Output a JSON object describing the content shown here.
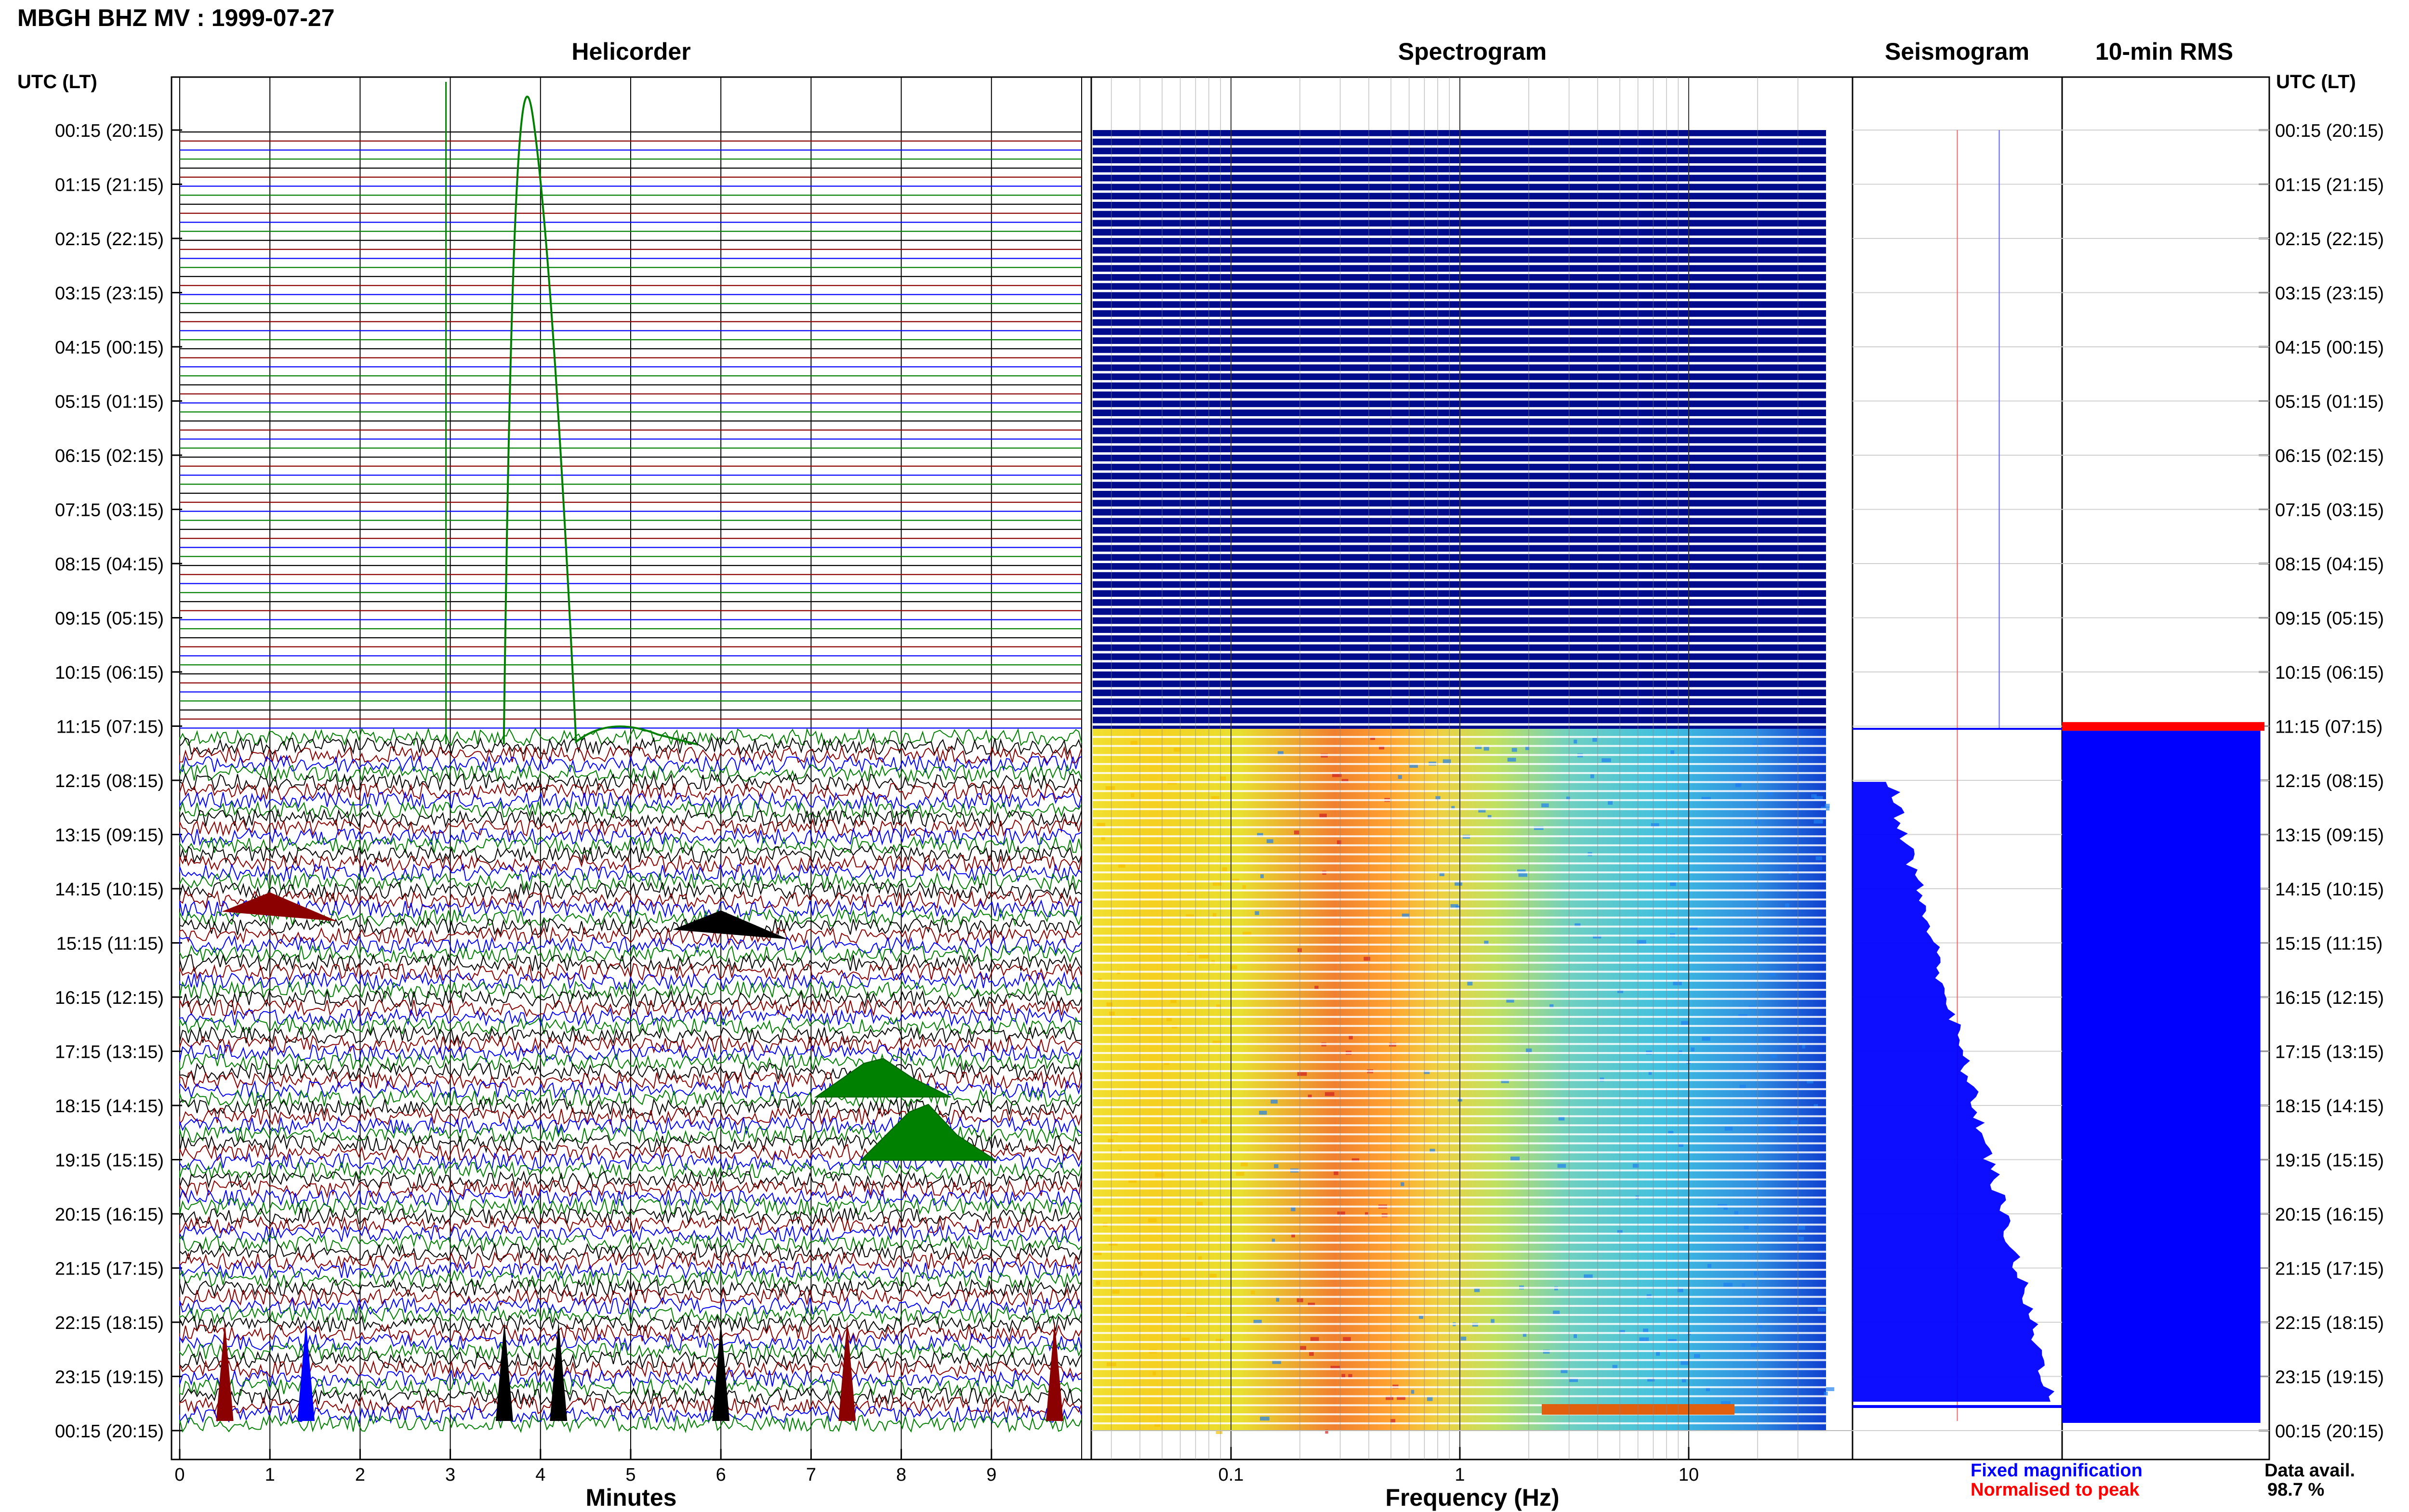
{
  "header": {
    "title": "MBGH BHZ MV : 1999-07-27"
  },
  "panels": {
    "helicorder": "Helicorder",
    "spectrogram": "Spectrogram",
    "seismogram": "Seismogram",
    "rms": "10-min RMS"
  },
  "axes": {
    "utc_label_left": "UTC (LT)",
    "utc_label_right": "UTC (LT)",
    "time_labels": [
      "00:15 (20:15)",
      "01:15 (21:15)",
      "02:15 (22:15)",
      "03:15 (23:15)",
      "04:15 (00:15)",
      "05:15 (01:15)",
      "06:15 (02:15)",
      "07:15 (03:15)",
      "08:15 (04:15)",
      "09:15 (05:15)",
      "10:15 (06:15)",
      "11:15 (07:15)",
      "12:15 (08:15)",
      "13:15 (09:15)",
      "14:15 (10:15)",
      "15:15 (11:15)",
      "16:15 (12:15)",
      "17:15 (13:15)",
      "18:15 (14:15)",
      "19:15 (15:15)",
      "20:15 (16:15)",
      "21:15 (17:15)",
      "22:15 (18:15)",
      "23:15 (19:15)",
      "00:15 (20:15)"
    ],
    "minutes_label": "Minutes",
    "minutes_ticks": [
      "0",
      "1",
      "2",
      "3",
      "4",
      "5",
      "6",
      "7",
      "8",
      "9"
    ],
    "frequency_label": "Frequency (Hz)",
    "frequency_ticks": [
      "0.1",
      "1",
      "10"
    ]
  },
  "legend": {
    "fixed": "Fixed magnification",
    "normalised": "Normalised to peak",
    "fixed_color": "#0000ff",
    "normalised_color": "#ff0000"
  },
  "availability": {
    "label": "Data avail.",
    "value": "98.7 %"
  },
  "colors": {
    "trace_cycle": [
      "#000000",
      "#8b0000",
      "#0000ff",
      "#008000"
    ],
    "spectrogram_empty": "#000c8c",
    "rms_fill": "#0000ff",
    "rms_peak": "#ff0000"
  },
  "chart_data": {
    "type": "heatmap",
    "title": "MBGH BHZ MV : 1999-07-27",
    "data_start_hour_utc": 11.3,
    "helicorder": {
      "xlabel": "Minutes",
      "xlim": [
        0,
        10
      ],
      "rows_per_hour": 6,
      "events": [
        {
          "start_utc": "11:35",
          "minute": 3.7,
          "type": "spike"
        },
        {
          "start_utc": "14:35",
          "minute": 1.0,
          "type": "burst"
        },
        {
          "start_utc": "14:55",
          "minute": 6.0,
          "type": "burst"
        },
        {
          "start_utc": "17:55",
          "minute": 7.8,
          "type": "tremor"
        },
        {
          "start_utc": "19:05",
          "minute": 8.3,
          "type": "tremor"
        },
        {
          "start_utc": "22:35",
          "minute": 0.5,
          "type": "event"
        },
        {
          "start_utc": "22:35",
          "minute": 1.4,
          "type": "event"
        },
        {
          "start_utc": "22:35",
          "minute": 3.6,
          "type": "event"
        },
        {
          "start_utc": "22:35",
          "minute": 4.2,
          "type": "event"
        },
        {
          "start_utc": "22:35",
          "minute": 6.0,
          "type": "event"
        },
        {
          "start_utc": "22:35",
          "minute": 7.4,
          "type": "event"
        },
        {
          "start_utc": "22:35",
          "minute": 9.7,
          "type": "event"
        }
      ]
    },
    "spectrogram": {
      "xlabel": "Frequency (Hz)",
      "xscale": "log",
      "xlim": [
        0.02,
        40
      ],
      "peak_band_hz": [
        0.2,
        0.5
      ],
      "late_peak_band_hz": [
        2,
        10
      ]
    },
    "seismogram": {
      "fixed_magnification_position": 0.7,
      "normalised_position": 0.5
    },
    "rms": {
      "first_bin_normalised": 1.0,
      "level_normalised": 0.98
    }
  }
}
